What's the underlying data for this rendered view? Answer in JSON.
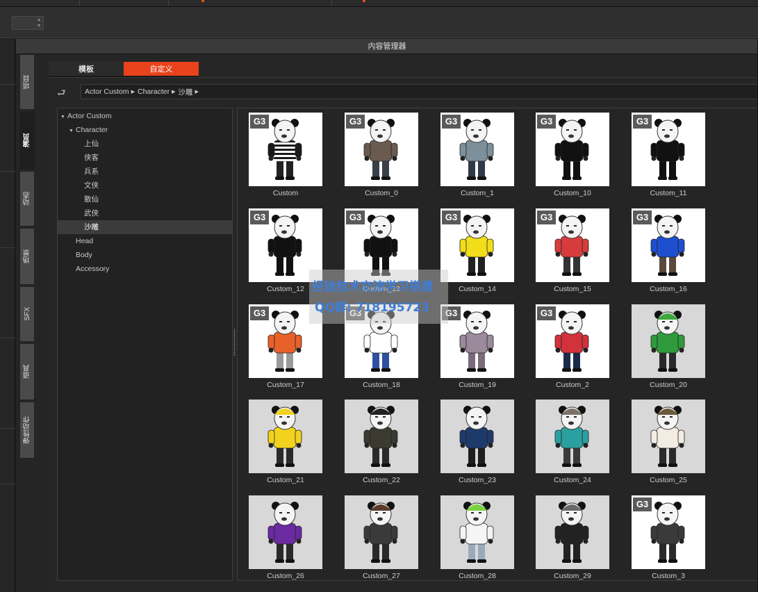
{
  "toolbar": {
    "spin_value": ""
  },
  "panel": {
    "title": "内容管理器"
  },
  "side_tabs": [
    {
      "label": "项目",
      "active": false
    },
    {
      "label": "演员",
      "active": true
    },
    {
      "label": "动态",
      "active": false
    },
    {
      "label": "场景",
      "active": false
    },
    {
      "label": "SFX",
      "active": false
    },
    {
      "label": "道具",
      "active": false
    },
    {
      "label": "弹性动作",
      "active": false
    }
  ],
  "top_tabs": [
    {
      "label": "模板",
      "active": false
    },
    {
      "label": "自定义",
      "active": true
    }
  ],
  "breadcrumb": [
    "Actor Custom",
    "Character",
    "沙雕"
  ],
  "tree": [
    {
      "label": "Actor Custom",
      "expanded": true,
      "selected": false
    },
    {
      "label": "Character",
      "expanded": true,
      "selected": false
    },
    {
      "label": "上仙",
      "selected": false
    },
    {
      "label": "侠客",
      "selected": false
    },
    {
      "label": "兵系",
      "selected": false
    },
    {
      "label": "文侠",
      "selected": false
    },
    {
      "label": "散仙",
      "selected": false
    },
    {
      "label": "武侠",
      "selected": false
    },
    {
      "label": "沙雕",
      "selected": true
    },
    {
      "label": "Head",
      "selected": false
    },
    {
      "label": "Body",
      "selected": false
    },
    {
      "label": "Accessory",
      "selected": false
    }
  ],
  "badge_text": "G3",
  "items": [
    {
      "label": "Custom",
      "g3": true,
      "bg": "white",
      "shirt": "#1a1a1a",
      "stripes": true,
      "pants": "#222222",
      "hat": ""
    },
    {
      "label": "Custom_0",
      "g3": true,
      "bg": "white",
      "shirt": "#6b5a50",
      "pants": "#3a4048",
      "hat": ""
    },
    {
      "label": "Custom_1",
      "g3": true,
      "bg": "white",
      "shirt": "#7d8f9a",
      "pants": "#2f3a48",
      "hat": ""
    },
    {
      "label": "Custom_10",
      "g3": true,
      "bg": "white",
      "shirt": "#111111",
      "pants": "#111111",
      "hat": ""
    },
    {
      "label": "Custom_11",
      "g3": true,
      "bg": "white",
      "shirt": "#111111",
      "pants": "#111111",
      "hat": ""
    },
    {
      "label": "Custom_12",
      "g3": true,
      "bg": "white",
      "shirt": "#111111",
      "pants": "#111111",
      "hat": ""
    },
    {
      "label": "Custom_13",
      "g3": true,
      "bg": "white",
      "shirt": "#111111",
      "pants": "#111111",
      "hat": ""
    },
    {
      "label": "Custom_14",
      "g3": true,
      "bg": "white",
      "shirt": "#f2dd1a",
      "pants": "#222222",
      "hat": ""
    },
    {
      "label": "Custom_15",
      "g3": true,
      "bg": "white",
      "shirt": "#d63c3c",
      "pants": "#333333",
      "hat": ""
    },
    {
      "label": "Custom_16",
      "g3": true,
      "bg": "white",
      "shirt": "#1e4fd0",
      "pants": "#5a4a3c",
      "hat": ""
    },
    {
      "label": "Custom_17",
      "g3": true,
      "bg": "white",
      "shirt": "#e8612a",
      "pants": "#9a9a9a",
      "hat": ""
    },
    {
      "label": "Custom_18",
      "g3": true,
      "bg": "white",
      "shirt": "#ffffff",
      "pants": "#2f4fa0",
      "hat": ""
    },
    {
      "label": "Custom_19",
      "g3": true,
      "bg": "white",
      "shirt": "#9b8a9b",
      "pants": "#7a6a7a",
      "hat": ""
    },
    {
      "label": "Custom_2",
      "g3": true,
      "bg": "white",
      "shirt": "#d2323c",
      "pants": "#1c2a4a",
      "hat": ""
    },
    {
      "label": "Custom_20",
      "g3": false,
      "bg": "grey",
      "shirt": "#2f9a3c",
      "pants": "#2a2a2a",
      "hat": "#3ca83c"
    },
    {
      "label": "Custom_21",
      "g3": false,
      "bg": "grey",
      "shirt": "#f2d21e",
      "pants": "#2a2a2a",
      "hat": "#f2d21e"
    },
    {
      "label": "Custom_22",
      "g3": false,
      "bg": "grey",
      "shirt": "#3a3a30",
      "pants": "#2a2a2a",
      "hat": "#222222"
    },
    {
      "label": "Custom_23",
      "g3": false,
      "bg": "grey",
      "shirt": "#1e3a6a",
      "pants": "#1e1e1e",
      "hat": ""
    },
    {
      "label": "Custom_24",
      "g3": false,
      "bg": "grey",
      "shirt": "#2aa0a0",
      "pants": "#3a3a3a",
      "hat": "#7a7268"
    },
    {
      "label": "Custom_25",
      "g3": false,
      "bg": "grey",
      "shirt": "#f2ece2",
      "pants": "#2a2a2a",
      "hat": "#6a5a3a"
    },
    {
      "label": "Custom_26",
      "g3": false,
      "bg": "grey",
      "shirt": "#6a2aa0",
      "pants": "#2a2a2a",
      "hat": ""
    },
    {
      "label": "Custom_27",
      "g3": false,
      "bg": "grey",
      "shirt": "#3a3a3a",
      "pants": "#2a2a2a",
      "hat": "#5a3a2a"
    },
    {
      "label": "Custom_28",
      "g3": false,
      "bg": "grey",
      "shirt": "#f5f5f5",
      "pants": "#9aaabb",
      "hat": "#7ad23c"
    },
    {
      "label": "Custom_29",
      "g3": false,
      "bg": "grey",
      "shirt": "#222222",
      "pants": "#222222",
      "hat": "#6a6a6a"
    },
    {
      "label": "Custom_3",
      "g3": true,
      "bg": "white",
      "shirt": "#3a3a3a",
      "pants": "#2a2a2a",
      "hat": ""
    }
  ],
  "watermark": {
    "line1": "经验技术交流学习搭建",
    "line2": "QQ群: 718195723"
  },
  "colors": {
    "accent": "#e8431c",
    "panel_bg": "#252525",
    "badge": "#5a5a5a"
  }
}
